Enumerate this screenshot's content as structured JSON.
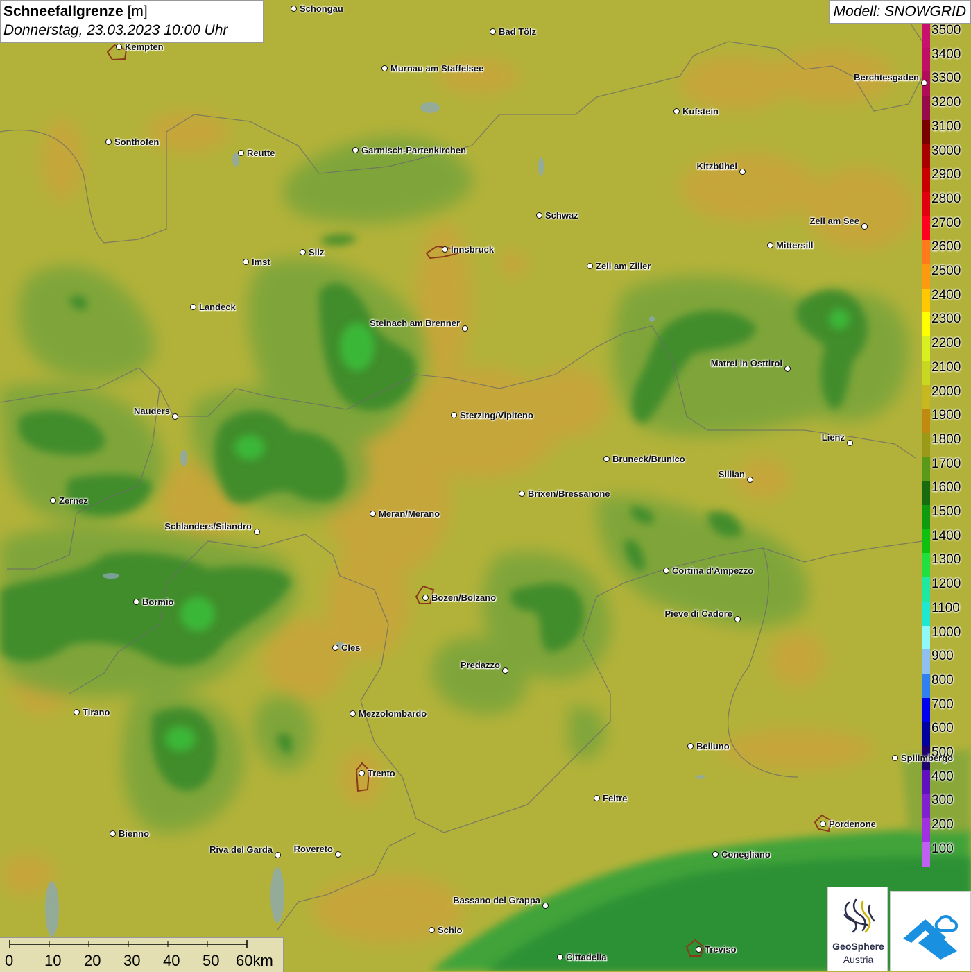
{
  "header": {
    "title_bold": "Schneefallgrenze",
    "title_unit": "[m]",
    "datetime": "Donnerstag, 23.03.2023 10:00 Uhr",
    "model": "Modell: SNOWGRID"
  },
  "legend": {
    "items": [
      {
        "value": "3500",
        "color": "#c8106e"
      },
      {
        "value": "3400",
        "color": "#c01066"
      },
      {
        "value": "3300",
        "color": "#b00c5a"
      },
      {
        "value": "3200",
        "color": "#980a4a"
      },
      {
        "value": "3100",
        "color": "#7a0000"
      },
      {
        "value": "3000",
        "color": "#a80000"
      },
      {
        "value": "2900",
        "color": "#c80000"
      },
      {
        "value": "2800",
        "color": "#e00010"
      },
      {
        "value": "2700",
        "color": "#ff0020"
      },
      {
        "value": "2600",
        "color": "#ff7a1a"
      },
      {
        "value": "2500",
        "color": "#ff9a10"
      },
      {
        "value": "2400",
        "color": "#ffc800"
      },
      {
        "value": "2300",
        "color": "#ffff00"
      },
      {
        "value": "2200",
        "color": "#d8f020"
      },
      {
        "value": "2100",
        "color": "#c8d820"
      },
      {
        "value": "2000",
        "color": "#c8b820"
      },
      {
        "value": "1900",
        "color": "#c08a10"
      },
      {
        "value": "1800",
        "color": "#9a9a18"
      },
      {
        "value": "1700",
        "color": "#5a9a18"
      },
      {
        "value": "1600",
        "color": "#1a6a10"
      },
      {
        "value": "1500",
        "color": "#109a10"
      },
      {
        "value": "1400",
        "color": "#10c010"
      },
      {
        "value": "1300",
        "color": "#20e040"
      },
      {
        "value": "1200",
        "color": "#20e8a0"
      },
      {
        "value": "1100",
        "color": "#20e8d0"
      },
      {
        "value": "1000",
        "color": "#90f8f8"
      },
      {
        "value": "900",
        "color": "#90c0f0"
      },
      {
        "value": "800",
        "color": "#3080f0"
      },
      {
        "value": "700",
        "color": "#0000f0"
      },
      {
        "value": "600",
        "color": "#0000a0"
      },
      {
        "value": "500",
        "color": "#200070"
      },
      {
        "value": "400",
        "color": "#6010c0"
      },
      {
        "value": "300",
        "color": "#8020d0"
      },
      {
        "value": "200",
        "color": "#a030e0"
      },
      {
        "value": "100",
        "color": "#c060f0"
      }
    ]
  },
  "cities": [
    {
      "name": "Schongau",
      "side": "right"
    },
    {
      "name": "Bad Tölz",
      "side": "right"
    },
    {
      "name": "Kempten",
      "side": "right"
    },
    {
      "name": "Murnau am Staffelsee",
      "side": "right"
    },
    {
      "name": "Berchtesgaden",
      "side": "left"
    },
    {
      "name": "Kufstein",
      "side": "right"
    },
    {
      "name": "Sonthofen",
      "side": "right"
    },
    {
      "name": "Reutte",
      "side": "right"
    },
    {
      "name": "Garmisch-Partenkirchen",
      "side": "right"
    },
    {
      "name": "Kitzbühel",
      "side": "left"
    },
    {
      "name": "Schwaz",
      "side": "right"
    },
    {
      "name": "Zell am See",
      "side": "left"
    },
    {
      "name": "Innsbruck",
      "side": "right"
    },
    {
      "name": "Mittersill",
      "side": "right"
    },
    {
      "name": "Imst",
      "side": "right"
    },
    {
      "name": "Silz",
      "side": "right"
    },
    {
      "name": "Zell am Ziller",
      "side": "right"
    },
    {
      "name": "Landeck",
      "side": "right"
    },
    {
      "name": "Steinach am Brenner",
      "side": "left"
    },
    {
      "name": "Matrei in Osttirol",
      "side": "left"
    },
    {
      "name": "Nauders",
      "side": "left"
    },
    {
      "name": "Sterzing/Vipiteno",
      "side": "right"
    },
    {
      "name": "Lienz",
      "side": "left"
    },
    {
      "name": "Bruneck/Brunico",
      "side": "right"
    },
    {
      "name": "Sillian",
      "side": "left"
    },
    {
      "name": "Brixen/Bressanone",
      "side": "right"
    },
    {
      "name": "Zernez",
      "side": "right"
    },
    {
      "name": "Meran/Merano",
      "side": "right"
    },
    {
      "name": "Schlanders/Silandro",
      "side": "left"
    },
    {
      "name": "Cortina d'Ampezzo",
      "side": "right"
    },
    {
      "name": "Bozen/Bolzano",
      "side": "right"
    },
    {
      "name": "Bormio",
      "side": "right"
    },
    {
      "name": "Pieve di Cadore",
      "side": "left"
    },
    {
      "name": "Cles",
      "side": "right"
    },
    {
      "name": "Predazzo",
      "side": "left"
    },
    {
      "name": "Tirano",
      "side": "right"
    },
    {
      "name": "Mezzolombardo",
      "side": "right"
    },
    {
      "name": "Belluno",
      "side": "right"
    },
    {
      "name": "Spilimbergo",
      "side": "right"
    },
    {
      "name": "Trento",
      "side": "right"
    },
    {
      "name": "Feltre",
      "side": "right"
    },
    {
      "name": "Pordenone",
      "side": "right"
    },
    {
      "name": "Bienno",
      "side": "right"
    },
    {
      "name": "Riva del Garda",
      "side": "left"
    },
    {
      "name": "Rovereto",
      "side": "left"
    },
    {
      "name": "Conegliano",
      "side": "right"
    },
    {
      "name": "Bassano del Grappa",
      "side": "left"
    },
    {
      "name": "Schio",
      "side": "right"
    },
    {
      "name": "Treviso",
      "side": "right"
    },
    {
      "name": "Cittadella",
      "side": "right"
    }
  ],
  "scale": {
    "labels": [
      "0",
      "10",
      "20",
      "30",
      "40",
      "50",
      "60km"
    ]
  },
  "logos": {
    "geosphere_line1": "GeoSphere",
    "geosphere_line2": "Austria"
  }
}
